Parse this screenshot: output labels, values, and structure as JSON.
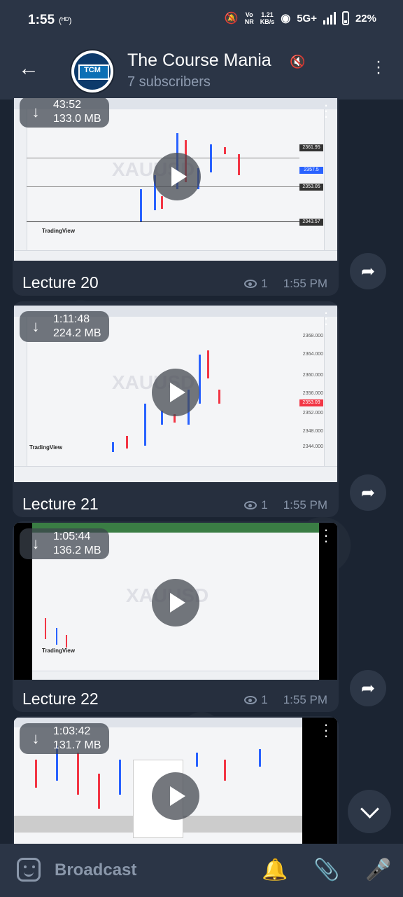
{
  "status_bar": {
    "time": "1:55",
    "hd_label": "(ᴴᴰ)",
    "network_speed_top": "1.21",
    "network_speed_bottom": "KB/s",
    "volte_top": "Vo",
    "volte_bottom": "NR",
    "network_type": "5G+",
    "battery": "22%"
  },
  "header": {
    "back_icon": "back-arrow-icon",
    "avatar_text": "TCM",
    "title": "The Course Mania",
    "subtitle": "7 subscribers",
    "muted_icon": "muted-icon"
  },
  "messages": [
    {
      "duration": "43:52",
      "size": "133.0 MB",
      "caption": "Lecture 20",
      "views": "1",
      "time": "1:55 PM"
    },
    {
      "duration": "1:11:48",
      "size": "224.2 MB",
      "caption": "Lecture 21",
      "views": "1",
      "time": "1:55 PM"
    },
    {
      "duration": "1:05:44",
      "size": "136.2 MB",
      "caption": "Lecture 22",
      "views": "1",
      "time": "1:55 PM"
    },
    {
      "duration": "1:03:42",
      "size": "131.7 MB",
      "caption": "",
      "views": "",
      "time": ""
    }
  ],
  "video_overlay": {
    "watermark": "XAUUSD",
    "tv_logo": "TradingView"
  },
  "bottom_bar": {
    "label": "Broadcast"
  },
  "colors": {
    "background": "#1b2432",
    "bar": "#2b3546",
    "bubble": "#262f3e",
    "muted_text": "#8794a8"
  }
}
